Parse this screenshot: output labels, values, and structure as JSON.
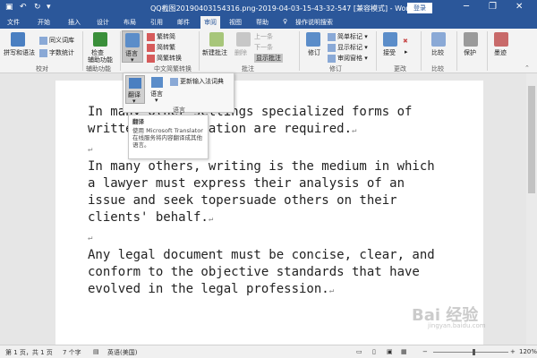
{
  "window": {
    "title": "QQ截图20190403154316.png-2019-04-03-15-43-32-547 [兼容模式] - Word",
    "login_label": "登录",
    "minimize": "─",
    "restore": "❐",
    "close": "✕"
  },
  "tabs": [
    "文件",
    "开始",
    "插入",
    "设计",
    "布局",
    "引用",
    "邮件",
    "审阅",
    "视图",
    "帮助",
    "操作说明搜索"
  ],
  "ribbon": {
    "proofing": {
      "spelling": "拼写和语法",
      "thesaurus": "同义词库",
      "wordcount": "字数统计",
      "group": "校对"
    },
    "accessibility": {
      "check": "检查",
      "check2": "辅助功能",
      "group": "辅助功能"
    },
    "language": {
      "label": "语言",
      "group": "语言"
    },
    "chinese": {
      "t2s": "繁转简",
      "s2t": "简转繁",
      "convert": "简繁转换",
      "group": "中文简繁转换"
    },
    "comments": {
      "new": "新建批注",
      "delete": "删除",
      "prev": "上一条",
      "next": "下一条",
      "show": "显示批注",
      "group": "批注"
    },
    "tracking": {
      "track": "修订",
      "simple": "简单标记",
      "showmarkup": "显示标记",
      "pane": "审阅窗格",
      "group": "修订"
    },
    "changes": {
      "accept": "接受",
      "group": "更改"
    },
    "compare": {
      "label": "比较",
      "group": "比较"
    },
    "protect": {
      "label": "保护"
    },
    "ink": {
      "label": "墨迹"
    }
  },
  "dropdown": {
    "translate": "翻译",
    "language": "语言",
    "update_ime": "更新输入法词典",
    "group": "语言"
  },
  "tooltip": {
    "title": "翻译",
    "body": "使用 Microsoft Translator 在线服务将内容翻译成其他语言。"
  },
  "document": {
    "para1_line1": "In many other settings specialized forms of",
    "para1_line2": "written communication are required.",
    "para2_line1": "In many others, writing is the medium in which",
    "para2_line2": "a lawyer must express their analysis of an",
    "para2_line3": "issue and seek topersuade others on their",
    "para2_line4": "clients' behalf.",
    "para3_line1": "Any legal document must be concise, clear, and",
    "para3_line2": "conform to the objective standards that have",
    "para3_line3": "evolved in the legal profession."
  },
  "status": {
    "page": "第 1 页，共 1 页",
    "words": "7 个字",
    "lang": "英语(美国)",
    "zoom": "120%"
  },
  "watermark": {
    "main": "Bai 经验",
    "sub": "jingyan.baidu.com"
  },
  "colors": {
    "titlebar": "#2b579a",
    "ribbon": "#f3f3f3"
  }
}
